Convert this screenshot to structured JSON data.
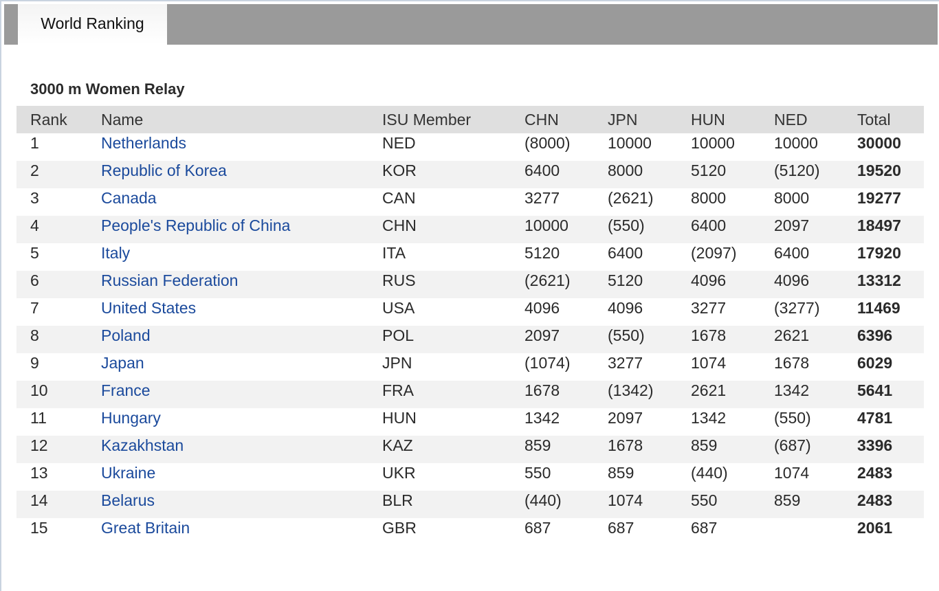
{
  "tab": {
    "label": "World Ranking"
  },
  "section": {
    "title": "3000 m Women Relay"
  },
  "table": {
    "headers": [
      "Rank",
      "Name",
      "ISU Member",
      "CHN",
      "JPN",
      "HUN",
      "NED",
      "Total"
    ],
    "rows": [
      [
        "1",
        "Netherlands",
        "NED",
        "(8000)",
        "10000",
        "10000",
        "10000",
        "30000"
      ],
      [
        "2",
        "Republic of Korea",
        "KOR",
        "6400",
        "8000",
        "5120",
        "(5120)",
        "19520"
      ],
      [
        "3",
        "Canada",
        "CAN",
        "3277",
        "(2621)",
        "8000",
        "8000",
        "19277"
      ],
      [
        "4",
        "People's Republic of China",
        "CHN",
        "10000",
        "(550)",
        "6400",
        "2097",
        "18497"
      ],
      [
        "5",
        "Italy",
        "ITA",
        "5120",
        "6400",
        "(2097)",
        "6400",
        "17920"
      ],
      [
        "6",
        "Russian Federation",
        "RUS",
        "(2621)",
        "5120",
        "4096",
        "4096",
        "13312"
      ],
      [
        "7",
        "United States",
        "USA",
        "4096",
        "4096",
        "3277",
        "(3277)",
        "11469"
      ],
      [
        "8",
        "Poland",
        "POL",
        "2097",
        "(550)",
        "1678",
        "2621",
        "6396"
      ],
      [
        "9",
        "Japan",
        "JPN",
        "(1074)",
        "3277",
        "1074",
        "1678",
        "6029"
      ],
      [
        "10",
        "France",
        "FRA",
        "1678",
        "(1342)",
        "2621",
        "1342",
        "5641"
      ],
      [
        "11",
        "Hungary",
        "HUN",
        "1342",
        "2097",
        "1342",
        "(550)",
        "4781"
      ],
      [
        "12",
        "Kazakhstan",
        "KAZ",
        "859",
        "1678",
        "859",
        "(687)",
        "3396"
      ],
      [
        "13",
        "Ukraine",
        "UKR",
        "550",
        "859",
        "(440)",
        "1074",
        "2483"
      ],
      [
        "14",
        "Belarus",
        "BLR",
        "(440)",
        "1074",
        "550",
        "859",
        "2483"
      ],
      [
        "15",
        "Great Britain",
        "GBR",
        "687",
        "687",
        "687",
        "",
        "2061"
      ]
    ]
  },
  "colors": {
    "tab_bar": "#9a9a9a",
    "header_bg": "#dfdfdf",
    "stripe_bg": "#f2f2f2",
    "link": "#1b4a9c"
  }
}
